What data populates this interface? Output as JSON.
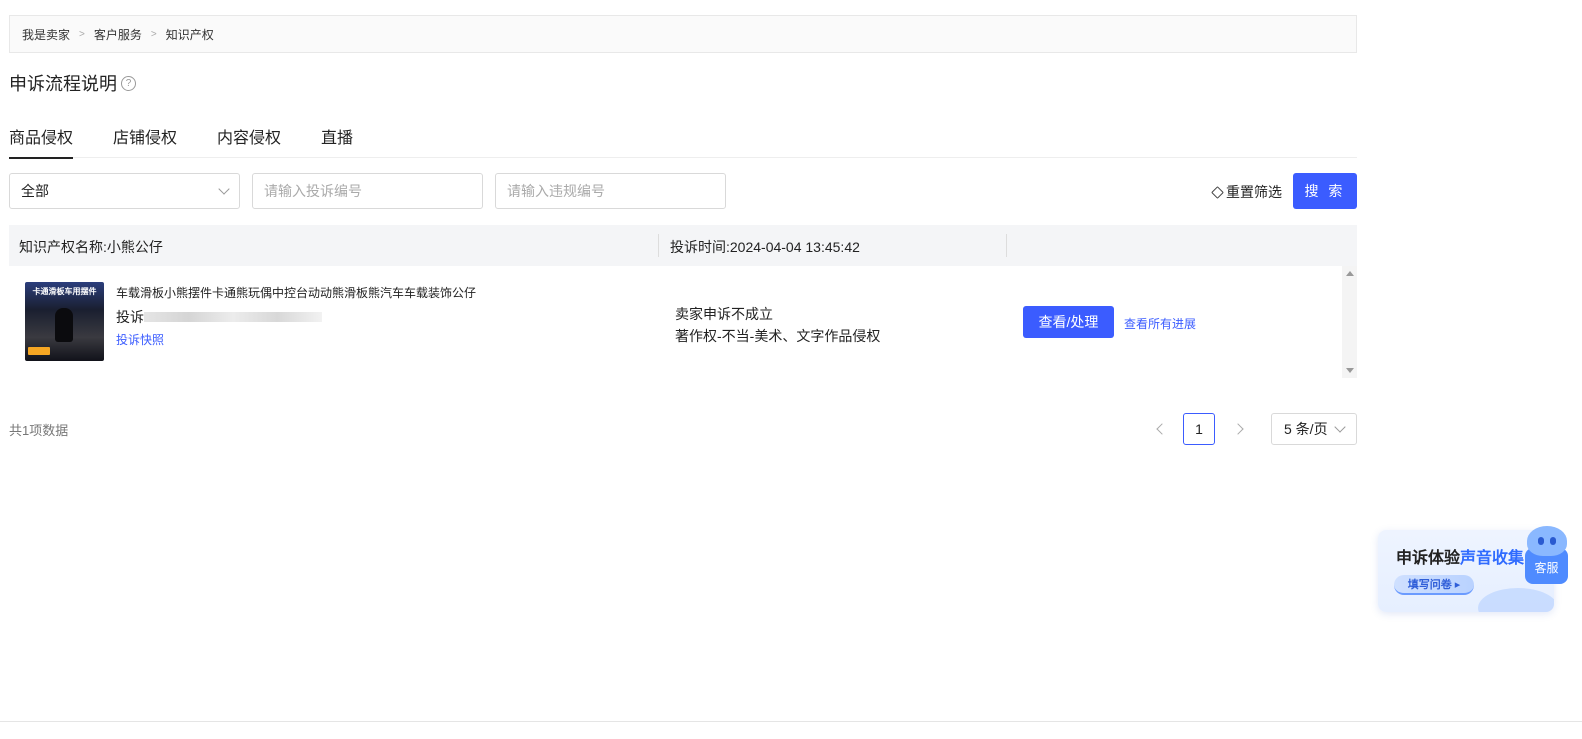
{
  "breadcrumb": {
    "items": [
      "我是卖家",
      "客户服务",
      "知识产权"
    ],
    "separator": ">"
  },
  "page_title": "申诉流程说明",
  "help_icon_glyph": "?",
  "tabs": [
    "商品侵权",
    "店铺侵权",
    "内容侵权",
    "直播"
  ],
  "active_tab": 0,
  "filters": {
    "type_select_value": "全部",
    "complaint_no_placeholder": "请输入投诉编号",
    "violation_no_placeholder": "请输入违规编号",
    "reset_label": "重置筛选",
    "search_label": "搜 索"
  },
  "table": {
    "ip_name": "知识产权名称:小熊公仔",
    "complaint_time": "投诉时间:2024-04-04 13:45:42",
    "row": {
      "thumb_text": "卡通滑板车用摆件",
      "product_name": "车载滑板小熊摆件卡通熊玩偶中控台动动熊滑板熊汽车车载装饰公仔",
      "complaint_prefix": "投诉",
      "snapshot_label": "投诉快照",
      "status": "卖家申诉不成立",
      "reason": "著作权-不当-美术、文字作品侵权",
      "handle_label": "查看/处理",
      "progress_label": "查看所有进展"
    }
  },
  "footer": {
    "total": "共1项数据",
    "current_page": "1",
    "page_size": "5 条/页"
  },
  "survey": {
    "title_plain": "申诉体验",
    "title_highlight": "声音收集",
    "button": "填写问卷 ▸"
  },
  "customer_service": "客服",
  "colors": {
    "primary": "#3b5cff",
    "survey_accent": "#2f6bff"
  }
}
